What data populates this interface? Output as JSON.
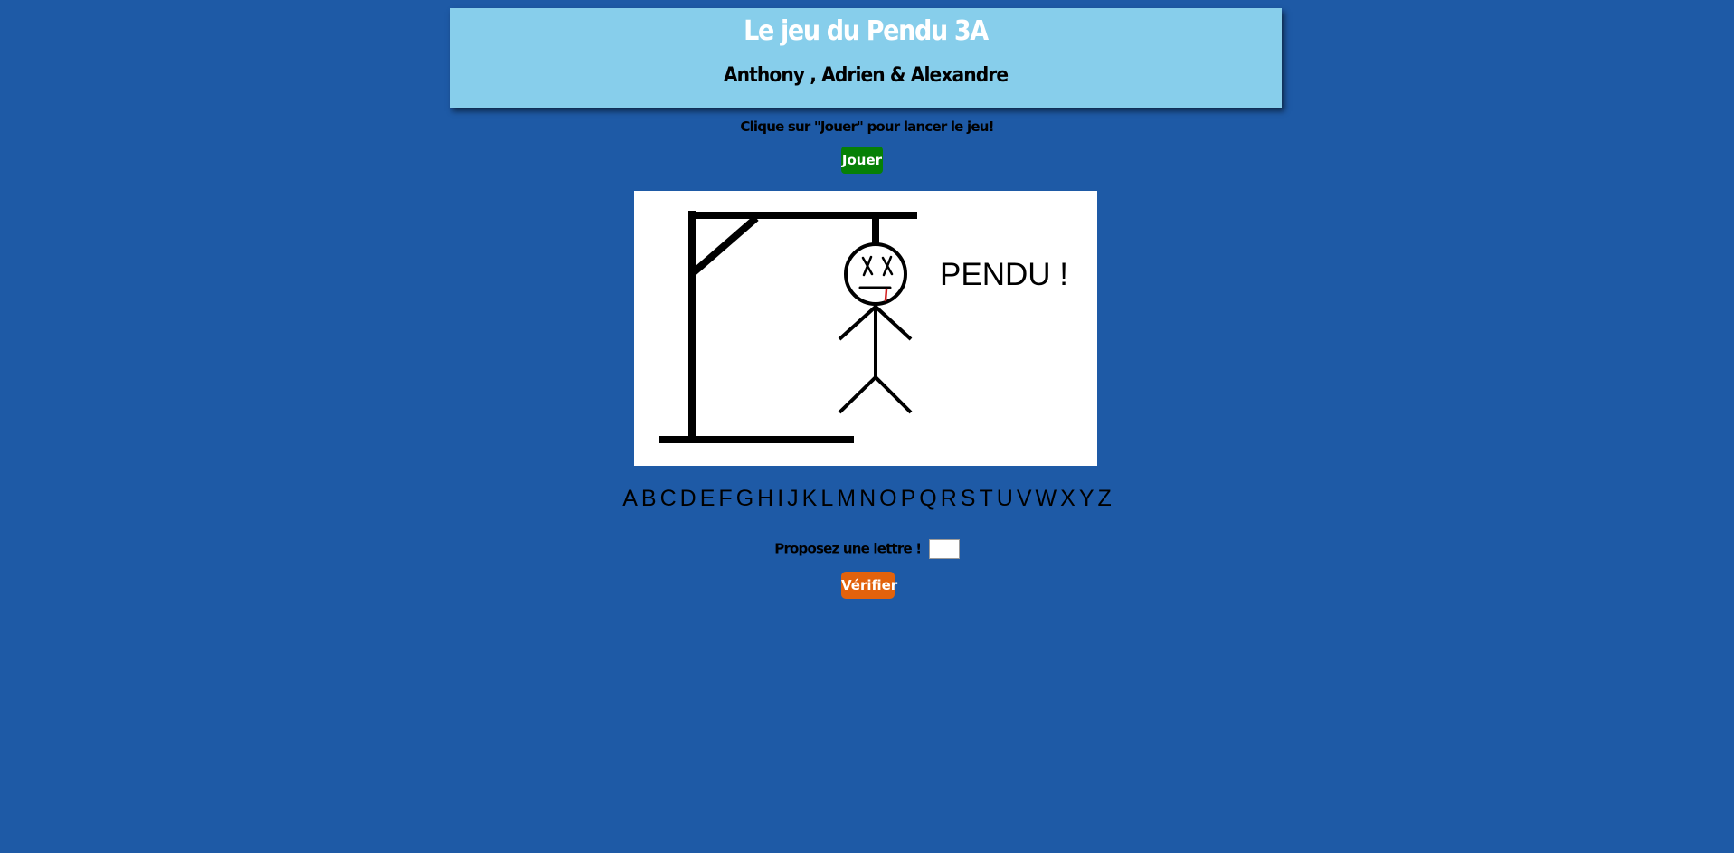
{
  "header": {
    "title": "Le jeu du Pendu 3A",
    "authors": "Anthony , Adrien & Alexandre"
  },
  "instruction": "Clique sur \"Jouer\" pour lancer le jeu!",
  "play_button": "Jouer",
  "board": {
    "message": "PENDU !"
  },
  "alphabet": [
    "A",
    "B",
    "C",
    "D",
    "E",
    "F",
    "G",
    "H",
    "I",
    "J",
    "K",
    "L",
    "M",
    "N",
    "O",
    "P",
    "Q",
    "R",
    "S",
    "T",
    "U",
    "V",
    "W",
    "X",
    "Y",
    "Z"
  ],
  "guess": {
    "label": "Proposez une lettre !",
    "value": ""
  },
  "check_button": "Vérifier",
  "colors": {
    "background": "#1e5aa6",
    "header": "#87ceeb",
    "play_button": "#068006",
    "check_button": "#e2620c"
  }
}
